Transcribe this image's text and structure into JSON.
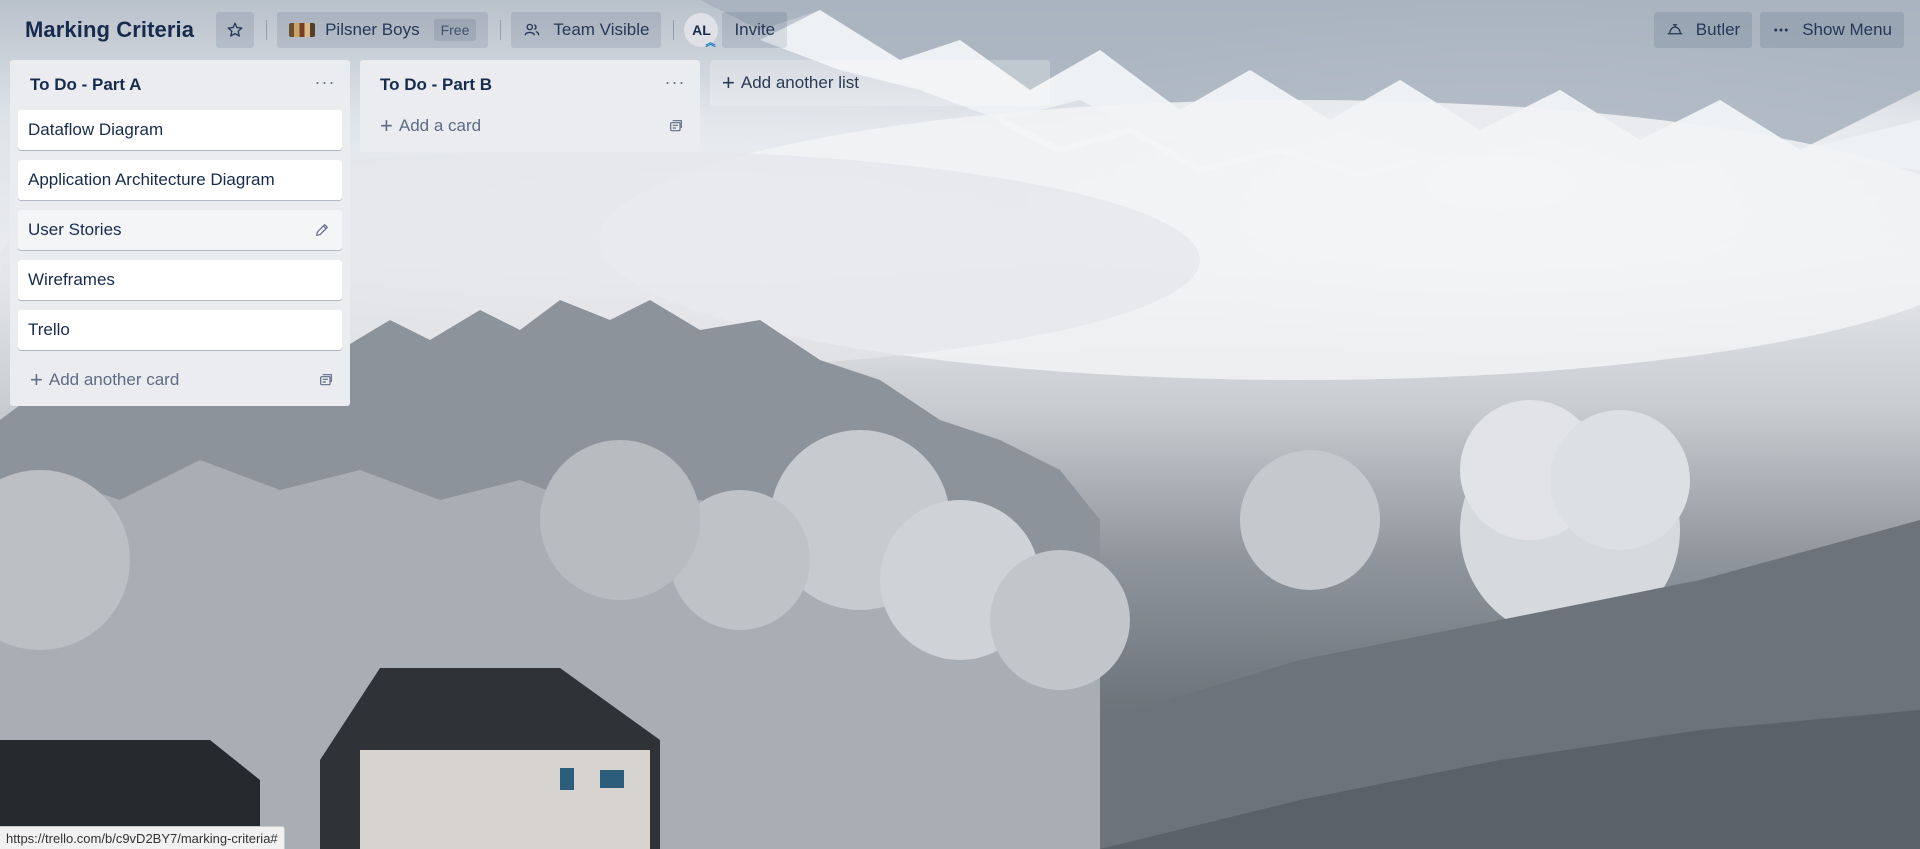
{
  "board": {
    "title": "Marking Criteria",
    "team_name": "Pilsner Boys",
    "team_badge": "Free",
    "visibility": "Team Visible",
    "member_initials": "AL",
    "invite_label": "Invite",
    "butler_label": "Butler",
    "menu_label": "Show Menu"
  },
  "lists": [
    {
      "title": "To Do - Part A",
      "menu_glyph": "···",
      "cards": [
        "Dataflow Diagram",
        "Application Architecture Diagram",
        "User Stories",
        "Wireframes",
        "Trello"
      ],
      "add_label": "Add another card"
    },
    {
      "title": "To Do - Part B",
      "menu_glyph": "···",
      "cards": [],
      "add_label": "Add a card"
    }
  ],
  "add_list_label": "Add another list",
  "status_url": "https://trello.com/b/c9vD2BY7/marking-criteria#",
  "icons": {
    "star": "star-icon",
    "visibility": "team-visible-icon",
    "butler": "butler-icon",
    "menu": "more-horizontal-icon",
    "edit": "pencil-icon",
    "template": "card-template-icon"
  },
  "colors": {
    "list_bg": "#ebecf0",
    "text_primary": "#172b4d",
    "text_subtle": "#5e6c84"
  }
}
